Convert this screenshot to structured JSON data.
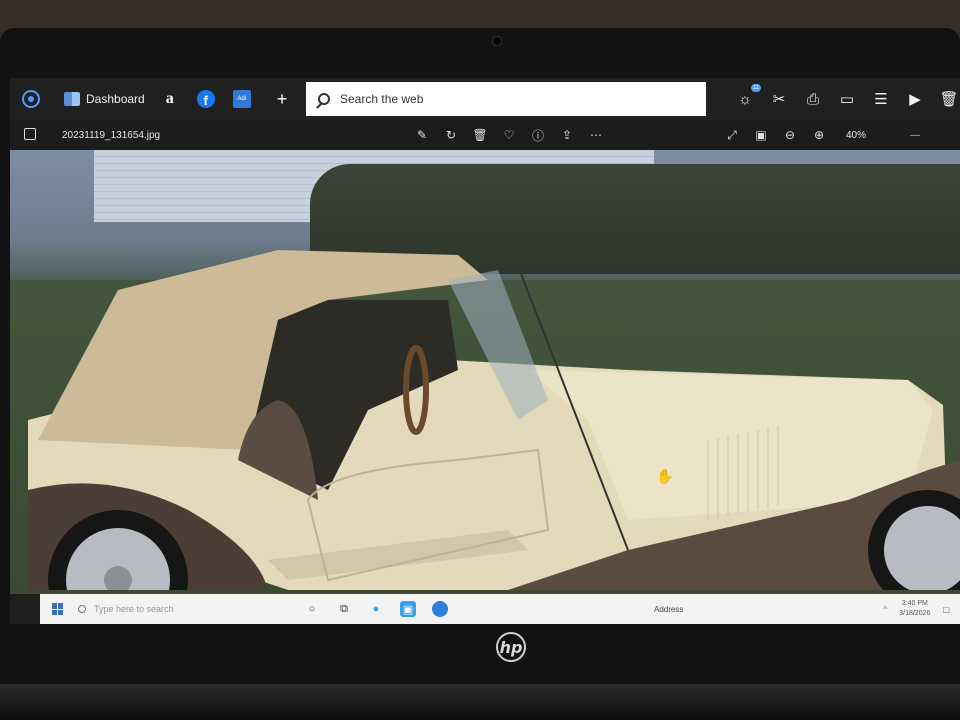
{
  "browser": {
    "dashboard_label": "Dashboard",
    "amazon_label": "a",
    "facebook_label": "f",
    "adi_label": "Adi",
    "new_tab_label": "+",
    "search_placeholder": "Search the web",
    "notification_count": "11"
  },
  "photo_viewer": {
    "filename": "20231119_131654.jpg",
    "zoom": "40%"
  },
  "taskbar": {
    "search_placeholder": "Type here to search",
    "address_label": "Address",
    "time": "3:40 PM",
    "date": "3/18/2026"
  },
  "device": {
    "brand": "hp"
  }
}
